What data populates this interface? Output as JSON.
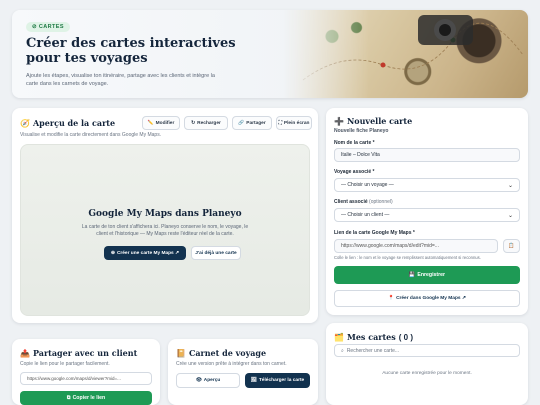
{
  "hero": {
    "badge": "⊘ CARTES",
    "title": "Créer des cartes interactives pour tes voyages",
    "subtitle": "Ajoute les étapes, visualise ton itinéraire, partage avec les clients et intègre la carte dans les carnets de voyage."
  },
  "preview": {
    "title": "Aperçu de la carte",
    "subtitle": "Visualise et modifie la carte directement dans Google My Maps.",
    "toolbar": {
      "edit": "Modifier",
      "reload": "Recharger",
      "share": "Partager",
      "fullscreen": "Plein écran"
    },
    "map_title": "Google My Maps dans Planeyo",
    "map_desc": "La carte de ton client s'affichera ici. Planeyo conserve le nom, le voyage, le client et l'historique — My Maps reste l'éditeur réel de la carte.",
    "create_button": "Créer une carte My Maps ↗",
    "have_button": "J'ai déjà une carte"
  },
  "newmap": {
    "title": "Nouvelle carte",
    "subtitle": "Nouvelle fiche Planeyo",
    "name_label": "Nom de la carte *",
    "name_value": "Italie – Dolce Vita",
    "trip_label": "Voyage associé *",
    "trip_value": "— Choisir un voyage —",
    "client_label": "Client associé",
    "client_optional": "(optionnel)",
    "client_value": "— Choisir un client —",
    "link_label": "Lien de la carte Google My Maps *",
    "link_placeholder": "https://www.google.com/maps/d/edit?mid=...",
    "link_hint": "Colle le lien : le nom et le voyage se remplissent automatiquement si reconnus.",
    "save_button": "Enregistrer",
    "create_button": "Créer dans Google My Maps ↗"
  },
  "mescartes": {
    "title": "Mes cartes",
    "count": "0",
    "search_placeholder": "Rechercher une carte...",
    "empty": "Aucune carte enregistrée pour le moment."
  },
  "share": {
    "title": "Partager avec un client",
    "subtitle": "Copie le lien pour le partager facilement.",
    "link_value": "https://www.google.com/maps/d/viewer?mid=...",
    "copy_button": "Copier le lien"
  },
  "carnet": {
    "title": "Carnet de voyage",
    "subtitle": "Crée une version prête à intégrer dans ton carnet.",
    "preview_button": "Aperçu",
    "download_button": "Télécharger la carte"
  },
  "colors": {
    "accent_green": "#1e9a55",
    "dark_navy": "#12324f"
  }
}
